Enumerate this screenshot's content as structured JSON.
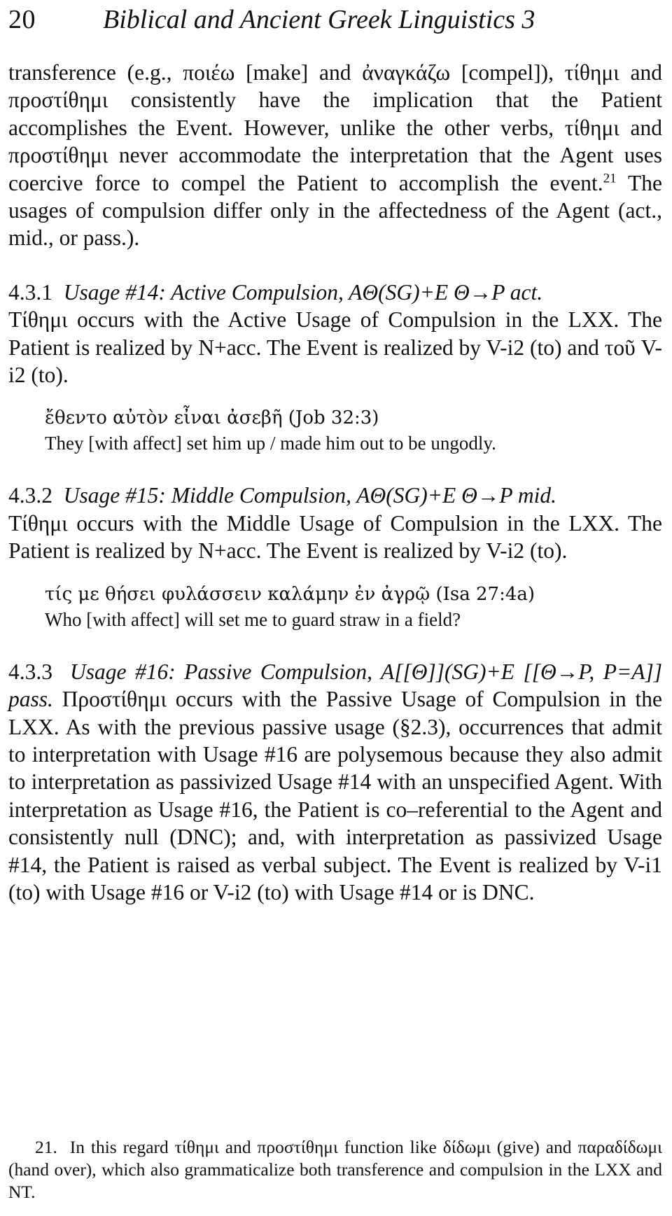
{
  "running_head": {
    "page_number": "20",
    "title": "Biblical and Ancient Greek Linguistics 3"
  },
  "body": {
    "paragraph_1": "transference (e.g., ποιέω [make] and ἀναγκάζω [compel]), τίθημι and προστίθημι consistently have the implication that the Patient accomplishes the Event. However, unlike the other verbs, τίθημι and προστίθημι never accommodate the interpretation that the Agent uses coercive force to compel the Patient to accomplish the event.",
    "footnote_marker_1": "21",
    "paragraph_1_cont": " The usages of compulsion differ only in the affectedness of the Agent (act., mid., or pass.)."
  },
  "sections": [
    {
      "number": "4.3.1",
      "title": "Usage #14: Active Compulsion, AΘ(SG)+E Θ→P act.",
      "text": "Τίθημι occurs with the Active Usage of Compulsion in the LXX. The Patient is realized by N+acc. The Event is realized by V-i2 (to) and τοῦ V-i2 (to).",
      "example": {
        "greek": "ἔθεντο αὐτὸν εἶναι ἀσεβῆ (Job 32:3)",
        "gloss": "They [with affect] set him up / made him out to be ungodly."
      }
    },
    {
      "number": "4.3.2",
      "title": "Usage #15: Middle Compulsion, AΘ(SG)+E Θ→P mid.",
      "text": "Τίθημι occurs with the Middle Usage of Compulsion in the LXX. The Patient is realized by N+acc. The Event is realized by V-i2 (to).",
      "example": {
        "greek": "τίς με θήσει φυλάσσειν καλάμην ἐν ἀγρῷ (Isa 27:4a)",
        "gloss": "Who [with affect] will set me to guard straw in a field?"
      }
    },
    {
      "number": "4.3.3",
      "title": "Usage #16: Passive Compulsion, A[[Θ]](SG)+E [[Θ→P, P=A]] pass.",
      "text": "Προστίθημι occurs with the Passive Usage of Compulsion in the LXX. As with the previous passive usage (§2.3), occurrences that admit to interpretation with Usage #16 are polysemous because they also admit to interpretation as passivized Usage #14 with an unspecified Agent. With interpretation as Usage #16, the Patient is co–referential to the Agent and consistently null (DNC); and, with interpretation as passivized Usage #14, the Patient is raised as verbal subject. The Event is realized by V-i1 (to) with Usage #16 or V-i2 (to) with Usage #14 or is DNC."
    }
  ],
  "footnote": {
    "number": "21.",
    "text": "In this regard τίθημι and προστίθημι function like δίδωμι (give) and παραδίδωμι (hand over), which also grammaticalize both transference and compulsion in the LXX and NT."
  }
}
